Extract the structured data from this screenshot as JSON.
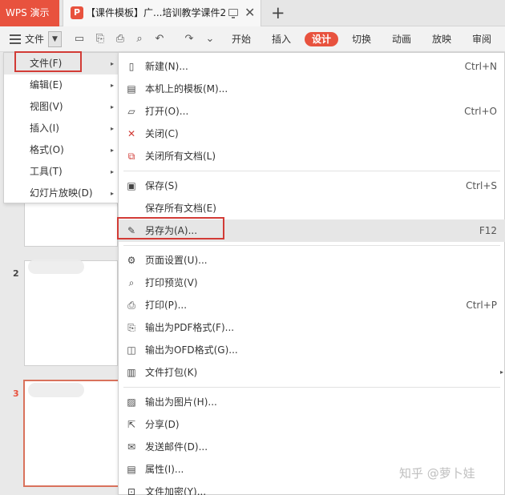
{
  "app": {
    "name": "WPS 演示",
    "doc_tab_title": "【课件模板】广...培训教学课件2",
    "new_tab": "+",
    "close": "✕"
  },
  "toolbar": {
    "file_label": "文件",
    "tabs": [
      "开始",
      "插入",
      "设计",
      "切换",
      "动画",
      "放映",
      "审阅"
    ],
    "active_tab": "设计"
  },
  "slides": {
    "numbers": [
      "2",
      "3"
    ],
    "current": "3"
  },
  "left_menu": {
    "items": [
      {
        "label": "文件(F)"
      },
      {
        "label": "编辑(E)"
      },
      {
        "label": "视图(V)"
      },
      {
        "label": "插入(I)"
      },
      {
        "label": "格式(O)"
      },
      {
        "label": "工具(T)"
      },
      {
        "label": "幻灯片放映(D)"
      }
    ],
    "arrow": "▸"
  },
  "sub_menu": {
    "items": [
      {
        "label": "新建(N)...",
        "shortcut": "Ctrl+N",
        "icon": "new-doc-icon"
      },
      {
        "label": "本机上的模板(M)...",
        "shortcut": "",
        "icon": "template-icon"
      },
      {
        "label": "打开(O)...",
        "shortcut": "Ctrl+O",
        "icon": "open-folder-icon"
      },
      {
        "label": "关闭(C)",
        "shortcut": "",
        "icon": "close-doc-icon"
      },
      {
        "label": "关闭所有文档(L)",
        "shortcut": "",
        "icon": "close-all-icon"
      },
      {
        "label": "保存(S)",
        "shortcut": "Ctrl+S",
        "icon": "save-icon"
      },
      {
        "label": "保存所有文档(E)",
        "shortcut": "",
        "icon": ""
      },
      {
        "label": "另存为(A)...",
        "shortcut": "F12",
        "icon": "save-as-icon"
      },
      {
        "label": "页面设置(U)...",
        "shortcut": "",
        "icon": "page-setup-icon"
      },
      {
        "label": "打印预览(V)",
        "shortcut": "",
        "icon": "print-preview-icon"
      },
      {
        "label": "打印(P)...",
        "shortcut": "Ctrl+P",
        "icon": "print-icon"
      },
      {
        "label": "输出为PDF格式(F)...",
        "shortcut": "",
        "icon": "pdf-icon"
      },
      {
        "label": "输出为OFD格式(G)...",
        "shortcut": "",
        "icon": "ofd-icon"
      },
      {
        "label": "文件打包(K)",
        "shortcut": "",
        "icon": "package-icon"
      },
      {
        "label": "输出为图片(H)...",
        "shortcut": "",
        "icon": "image-icon"
      },
      {
        "label": "分享(D)",
        "shortcut": "",
        "icon": "share-icon"
      },
      {
        "label": "发送邮件(D)...",
        "shortcut": "",
        "icon": "mail-icon"
      },
      {
        "label": "属性(I)...",
        "shortcut": "",
        "icon": "properties-icon"
      },
      {
        "label": "文件加密(Y)...",
        "shortcut": "",
        "icon": "encrypt-icon"
      }
    ],
    "arrow": "▸"
  },
  "watermark": "知乎 @萝卜娃",
  "colors": {
    "accent": "#e8523e",
    "highlight": "#d23b36"
  }
}
